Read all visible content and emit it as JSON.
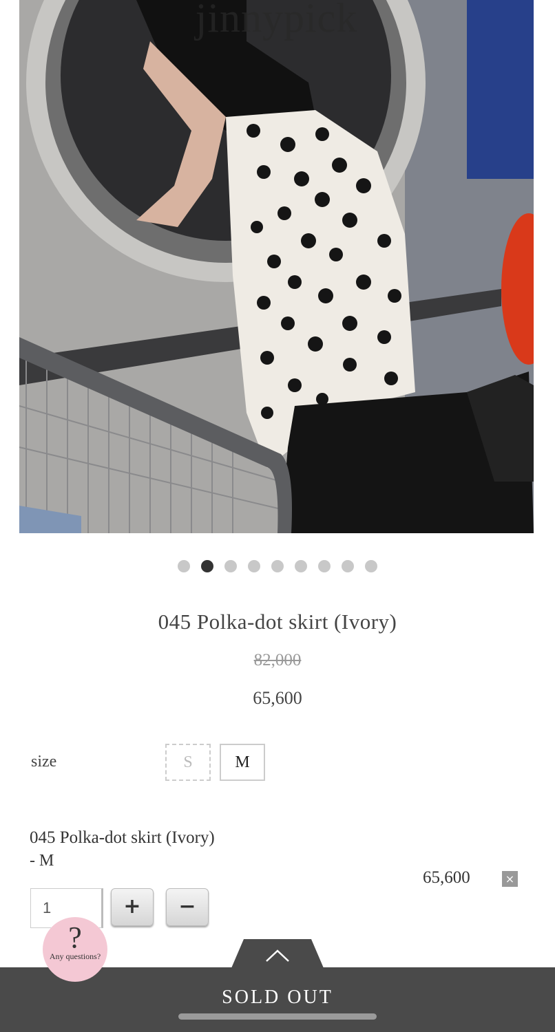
{
  "brand": "jinnypick",
  "carousel": {
    "count": 9,
    "active": 1
  },
  "product": {
    "title": "045 Polka-dot skirt (Ivory)",
    "original_price": "82,000",
    "sale_price": "65,600"
  },
  "size": {
    "label": "size",
    "options": [
      "S",
      "M"
    ],
    "unavailable": [
      "S"
    ]
  },
  "selection": {
    "title": "045 Polka-dot skirt (Ivory)",
    "option": "- M",
    "price": "65,600",
    "remove_icon": "×",
    "quantity": "1",
    "plus": "+",
    "minus": "−"
  },
  "help": {
    "symbol": "?",
    "text": "Any questions?"
  },
  "cta": {
    "label": "SOLD OUT"
  }
}
